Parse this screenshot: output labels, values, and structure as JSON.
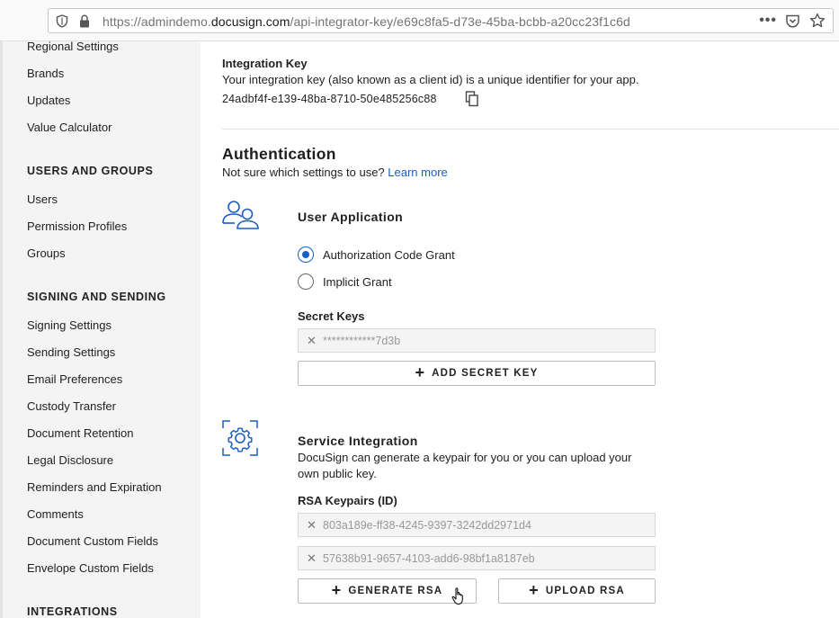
{
  "browser": {
    "url_prefix": "https://admindemo.",
    "url_host": "docusign.com",
    "url_path": "/api-integrator-key/e69c8fa5-d73e-45ba-bcbb-a20cc23f1c6d",
    "menu_dots": "•••",
    "icons": [
      "shield-icon",
      "lock-icon",
      "pocket-icon",
      "star-icon"
    ]
  },
  "sidebar": {
    "items_top": [
      "Regional Settings",
      "Brands",
      "Updates",
      "Value Calculator"
    ],
    "users_groups_heading": "USERS AND GROUPS",
    "users_groups": [
      "Users",
      "Permission Profiles",
      "Groups"
    ],
    "signing_heading": "SIGNING AND SENDING",
    "signing": [
      "Signing Settings",
      "Sending Settings",
      "Email Preferences",
      "Custody Transfer",
      "Document Retention",
      "Legal Disclosure",
      "Reminders and Expiration",
      "Comments",
      "Document Custom Fields",
      "Envelope Custom Fields"
    ],
    "integrations_heading": "INTEGRATIONS"
  },
  "main": {
    "integration_key_title": "Integration Key",
    "integration_key_desc": "Your integration key (also known as a client id) is a unique identifier for your app.",
    "integration_key_value": "24adbf4f-e139-48ba-8710-50e485256c88",
    "auth_title": "Authentication",
    "auth_help": "Not sure which settings to use?",
    "auth_help_link": "Learn more",
    "user_app_title": "User Application",
    "radio_auth_code": "Authorization Code Grant",
    "radio_implicit": "Implicit Grant",
    "selected_grant": "Authorization Code Grant",
    "secret_keys_label": "Secret Keys",
    "secret_key_value": "************7d3b",
    "add_secret_key": "ADD SECRET KEY",
    "service_title": "Service Integration",
    "service_desc_line1": "DocuSign can generate a keypair for you or you can upload your",
    "service_desc_line2": "own public key.",
    "rsa_label": "RSA Keypairs (ID)",
    "rsa_keys": [
      "803a189e-ff38-4245-9397-3242dd2971d4",
      "57638b91-9657-4103-add6-98bf1a8187eb"
    ],
    "generate_rsa": "GENERATE RSA",
    "upload_rsa": "UPLOAD RSA",
    "remove_glyph": "✕"
  },
  "colors": {
    "accent": "#1a5dc4",
    "sidebar_bg": "#f4f4f4",
    "field_bg": "#f4f4f4"
  }
}
